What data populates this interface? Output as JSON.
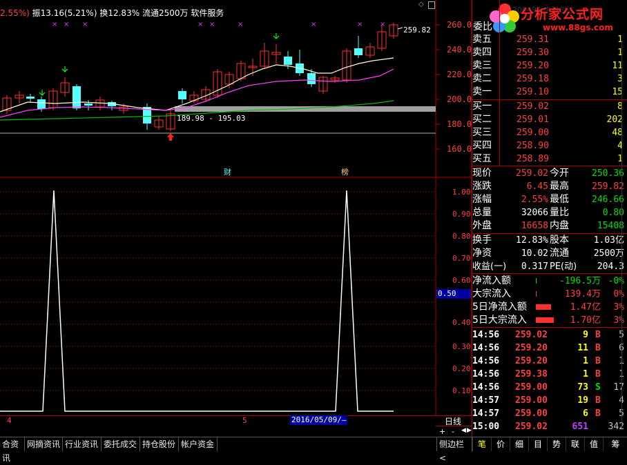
{
  "header": {
    "pct_partial": "2.55%)",
    "zhen_label": "振",
    "zhen_value": "13.16(5.21%)",
    "huan_label": "换",
    "huan_value": "12.83%",
    "liutong_label": "流通",
    "liutong_value": "2500万",
    "service_label": "软件服务",
    "faint_code": "300496 中科创达"
  },
  "logo": {
    "brand_cn": "分析家公式网",
    "brand_url": "www.88gs.com"
  },
  "main_chart": {
    "y_ticks": [
      "260.0",
      "240.0",
      "220.0",
      "200.0",
      "180.0",
      "160.0"
    ],
    "max_label": "259.82",
    "range_label": "189.98 - 195.03",
    "marker_cai": "财",
    "marker_bang": "榜",
    "colors": {
      "up": "#ff3030",
      "down": "#54ffff",
      "ma1": "#ffffe0",
      "ma2": "#ff40ff",
      "ma3": "#00c000",
      "ma4": "#c0c0c0"
    }
  },
  "indicator": {
    "y_ticks": [
      "1.00",
      "0.90",
      "0.80",
      "0.70",
      "0.60",
      "0.50",
      "0.40",
      "0.30",
      "0.20",
      "0.10"
    ],
    "current_value": "0.50"
  },
  "timeline": {
    "label_4": "4",
    "label_5": "5",
    "cursor_date": "2016/05/09/—",
    "period": "日线",
    "plus": "+",
    "minus": "-"
  },
  "bottom_tabs": [
    "合资讯",
    "网摘资讯",
    "行业资讯",
    "委托成交",
    "持仓股份",
    "帐户资金"
  ],
  "side_toggle": "侧边栏<",
  "right_tabs": [
    "笔",
    "价",
    "细",
    "目",
    "势",
    "联",
    "值",
    "筹"
  ],
  "order_book": {
    "header_label": "委比",
    "asks": [
      {
        "label": "卖五",
        "price": "259.31",
        "vol": "1"
      },
      {
        "label": "卖四",
        "price": "259.30",
        "vol": "1"
      },
      {
        "label": "卖三",
        "price": "259.20",
        "vol": "11"
      },
      {
        "label": "卖二",
        "price": "259.18",
        "vol": "3"
      },
      {
        "label": "卖一",
        "price": "259.10",
        "vol": "15"
      }
    ],
    "bids": [
      {
        "label": "买一",
        "price": "259.02",
        "vol": "8"
      },
      {
        "label": "买二",
        "price": "259.01",
        "vol": "202"
      },
      {
        "label": "买三",
        "price": "259.00",
        "vol": "48"
      },
      {
        "label": "买四",
        "price": "258.90",
        "vol": "4"
      },
      {
        "label": "买五",
        "price": "258.89",
        "vol": "1"
      }
    ]
  },
  "quote": [
    {
      "l1": "现价",
      "v1": "259.02",
      "c1": "red",
      "l2": "今开",
      "v2": "250.36",
      "c2": "green"
    },
    {
      "l1": "涨跌",
      "v1": "6.45",
      "c1": "red",
      "l2": "最高",
      "v2": "259.82",
      "c2": "red"
    },
    {
      "l1": "涨幅",
      "v1": "2.55%",
      "c1": "red",
      "l2": "最低",
      "v2": "246.66",
      "c2": "green"
    },
    {
      "l1": "总量",
      "v1": "32066",
      "c1": "white",
      "l2": "量比",
      "v2": "0.80",
      "c2": "green"
    },
    {
      "l1": "外盘",
      "v1": "16658",
      "c1": "red",
      "l2": "内盘",
      "v2": "15408",
      "c2": "green"
    }
  ],
  "fundamentals": [
    {
      "l1": "换手",
      "v1": "12.83%",
      "l2": "股本",
      "v2": "1.03亿"
    },
    {
      "l1": "净资",
      "v1": "10.02",
      "l2": "流通",
      "v2": "2500万"
    },
    {
      "l1": "收益(一)",
      "v1": "0.317",
      "l2": "PE(动)",
      "v2": "204.3"
    }
  ],
  "flows": [
    {
      "label": "净流入额",
      "value": "-196.5万",
      "pct": "-0%",
      "vcolor": "green",
      "pcolor": "green",
      "bar": "tick"
    },
    {
      "label": "大宗流入",
      "value": "139.4万",
      "pct": "0%",
      "vcolor": "red",
      "pcolor": "red",
      "bar": "tick"
    },
    {
      "label": "5日净流入额",
      "value": "1.47亿",
      "pct": "3%",
      "vcolor": "red",
      "pcolor": "red",
      "bar": "bar"
    },
    {
      "label": "5日大宗流入",
      "value": "1.70亿",
      "pct": "3%",
      "vcolor": "red",
      "pcolor": "red",
      "bar": "bar"
    }
  ],
  "ticks": [
    {
      "time": "14:56",
      "price": "259.02",
      "vol": "9",
      "side": "B",
      "n": "5"
    },
    {
      "time": "14:56",
      "price": "259.20",
      "vol": "11",
      "side": "B",
      "n": "6"
    },
    {
      "time": "14:56",
      "price": "259.20",
      "vol": "1",
      "side": "B",
      "n": "1"
    },
    {
      "time": "14:56",
      "price": "259.38",
      "vol": "1",
      "side": "B",
      "n": "1"
    },
    {
      "time": "14:56",
      "price": "259.00",
      "vol": "73",
      "side": "S",
      "n": "17"
    },
    {
      "time": "14:57",
      "price": "259.00",
      "vol": "19",
      "side": "B",
      "n": "4"
    },
    {
      "time": "14:57",
      "price": "259.00",
      "vol": "6",
      "side": "B",
      "n": "5"
    },
    {
      "time": "15:00",
      "price": "259.02",
      "vol": "651",
      "side": "",
      "n": "342"
    }
  ]
}
